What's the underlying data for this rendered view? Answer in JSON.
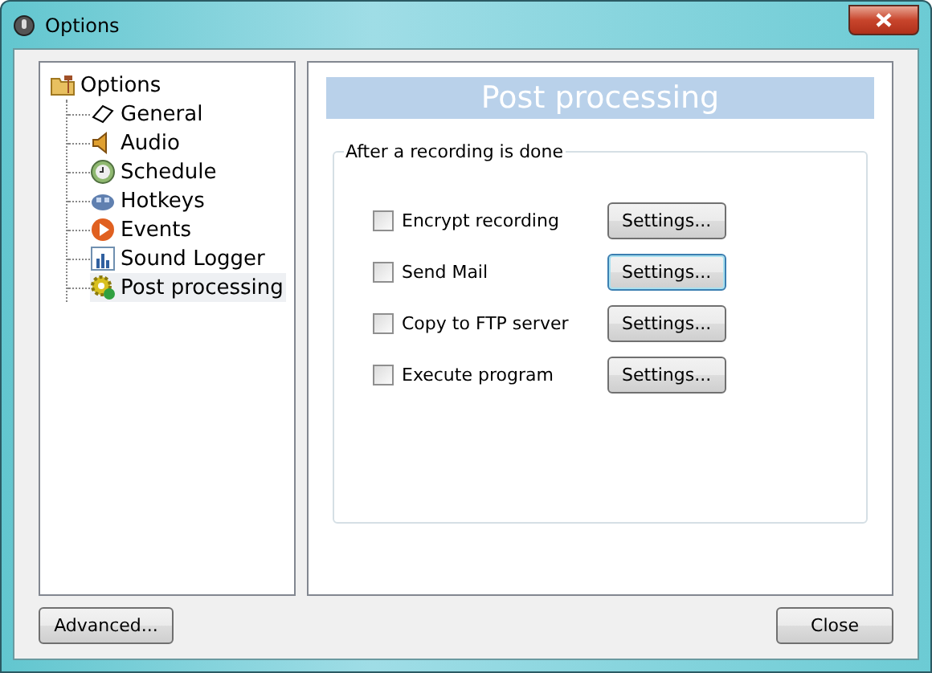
{
  "window": {
    "title": "Options"
  },
  "tree": [
    {
      "label": "Options",
      "selected": false,
      "children": [
        {
          "label": "General",
          "selected": false
        },
        {
          "label": "Audio",
          "selected": false
        },
        {
          "label": "Schedule",
          "selected": false
        },
        {
          "label": "Hotkeys",
          "selected": false
        },
        {
          "label": "Events",
          "selected": false
        },
        {
          "label": "Sound Logger",
          "selected": false
        },
        {
          "label": "Post processing",
          "selected": true
        }
      ]
    }
  ],
  "panel": {
    "title": "Post processing",
    "group_title": "After a recording is done",
    "options": [
      {
        "label": "Encrypt recording",
        "checked": false,
        "button": "Settings...",
        "focused": false
      },
      {
        "label": "Send Mail",
        "checked": false,
        "button": "Settings...",
        "focused": true
      },
      {
        "label": "Copy to FTP server",
        "checked": false,
        "button": "Settings...",
        "focused": false
      },
      {
        "label": "Execute program",
        "checked": false,
        "button": "Settings...",
        "focused": false
      }
    ]
  },
  "buttons": {
    "left": "Advanced...",
    "right": "Close"
  }
}
